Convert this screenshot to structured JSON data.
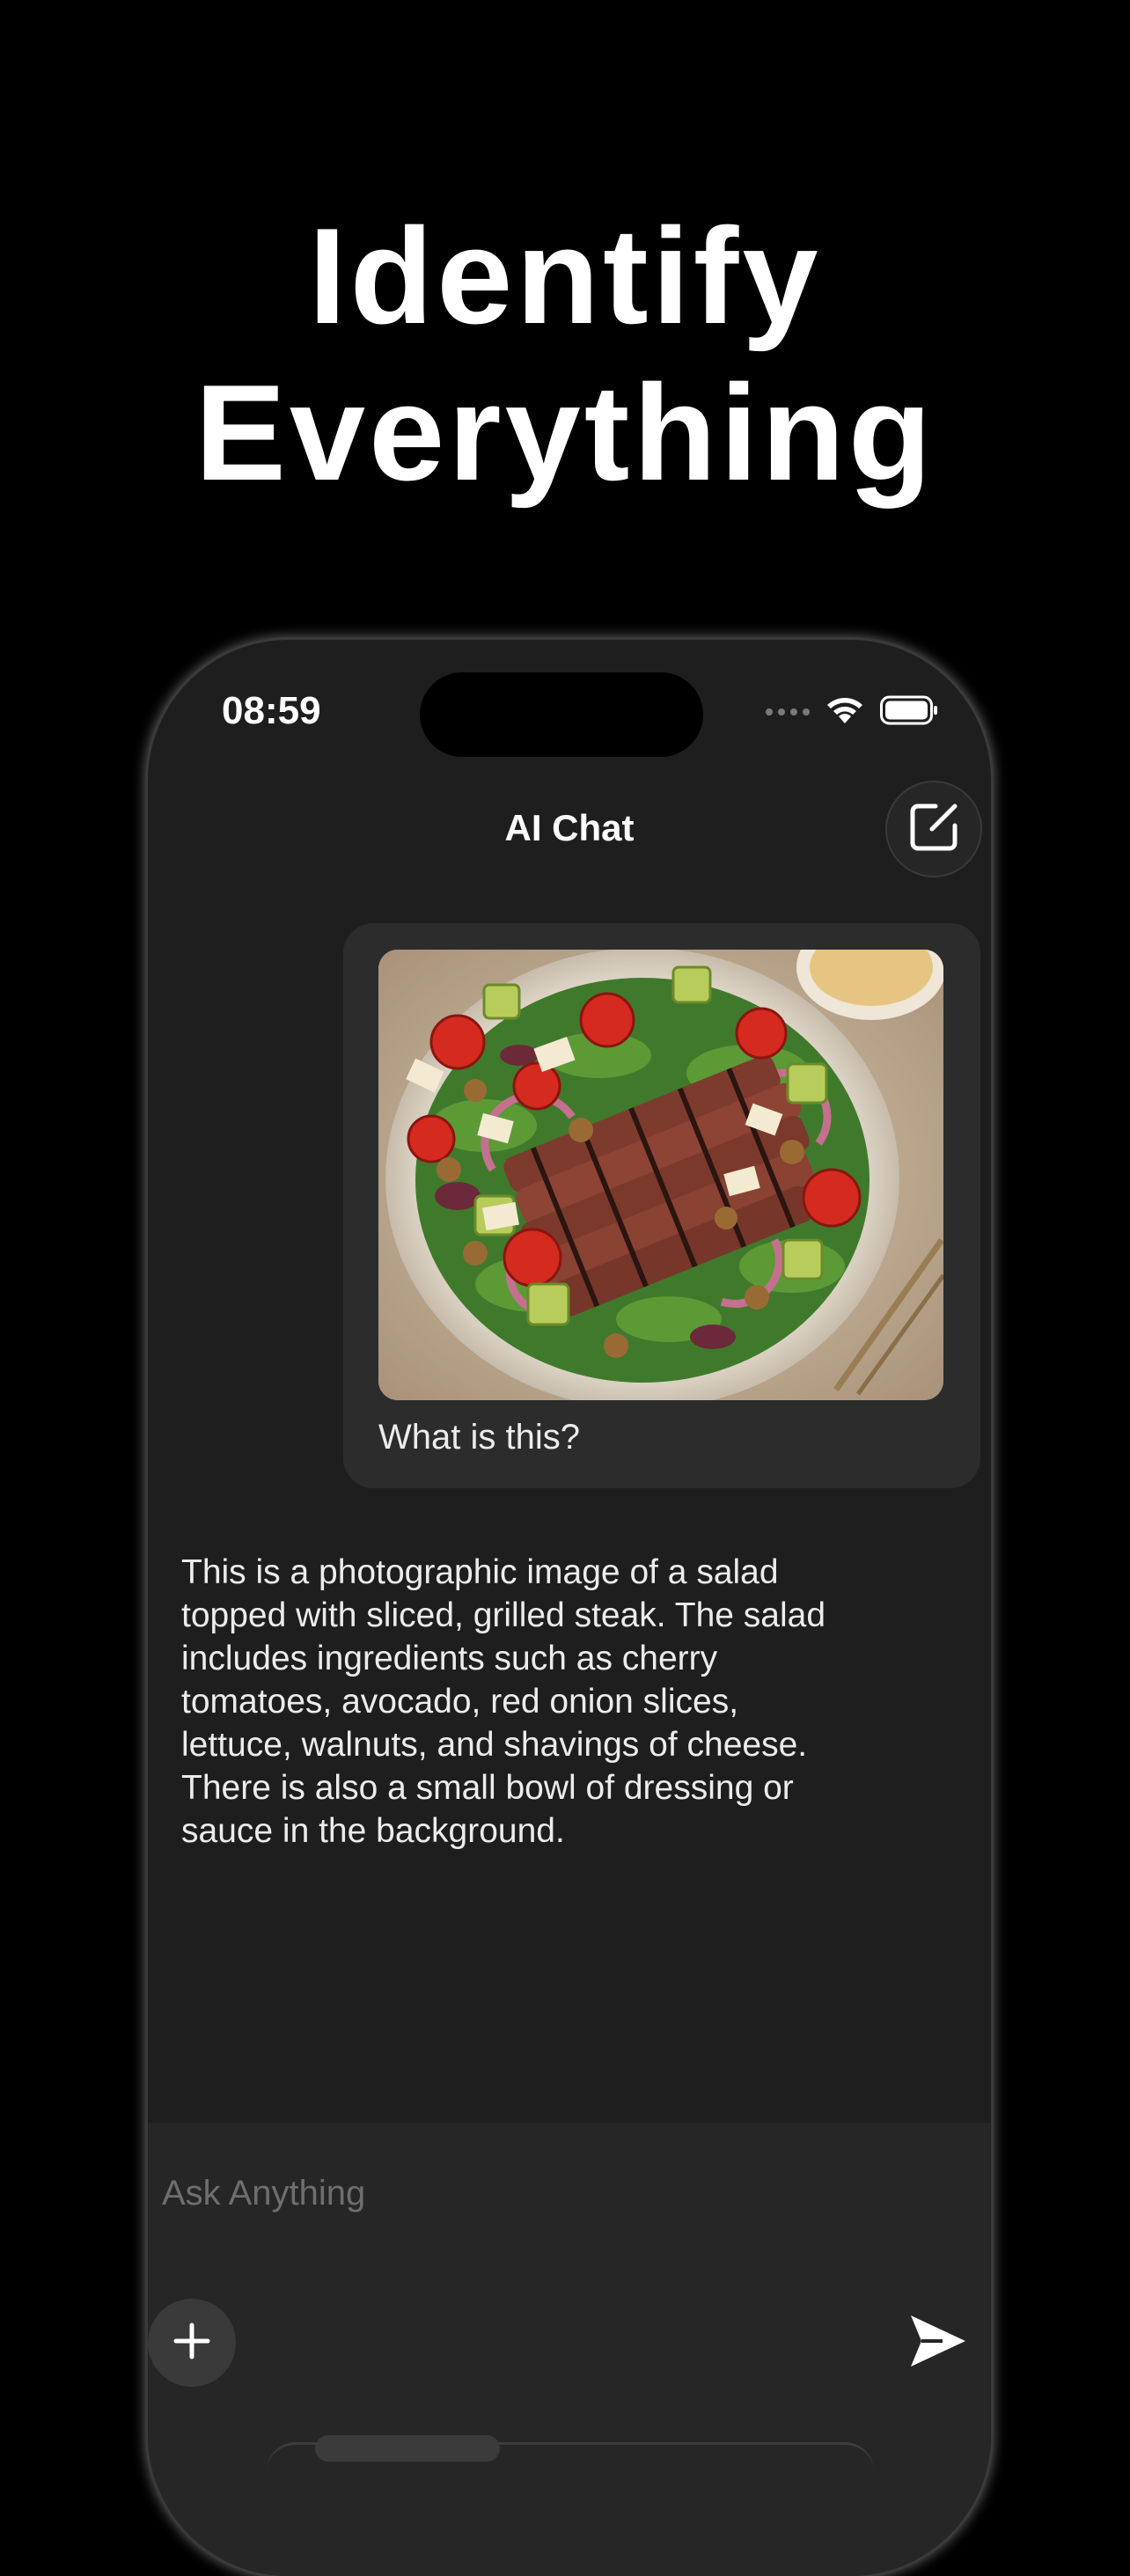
{
  "headline": {
    "line1": "Identify",
    "line2": "Everything"
  },
  "status_bar": {
    "time": "08:59",
    "wifi_icon": "wifi-icon",
    "battery_icon": "battery-icon"
  },
  "nav": {
    "title": "AI Chat",
    "compose_icon": "compose-icon"
  },
  "messages": {
    "user": {
      "image_description_icon": "salad-steak-photo",
      "text": "What is this?"
    },
    "assistant": {
      "text": "This is a photographic image of a salad topped with sliced, grilled steak. The salad includes ingredients such as cherry tomatoes, avocado, red onion slices, lettuce, walnuts, and shavings of cheese. There is also a small bowl of dressing or sauce in the background."
    }
  },
  "composer": {
    "placeholder": "Ask Anything",
    "plus_icon": "plus-icon",
    "send_icon": "send-icon"
  },
  "colors": {
    "background": "#000000",
    "screen": "#1e1e1e",
    "bubble": "#2c2c2c",
    "composer": "#262626",
    "text": "#ececec"
  }
}
